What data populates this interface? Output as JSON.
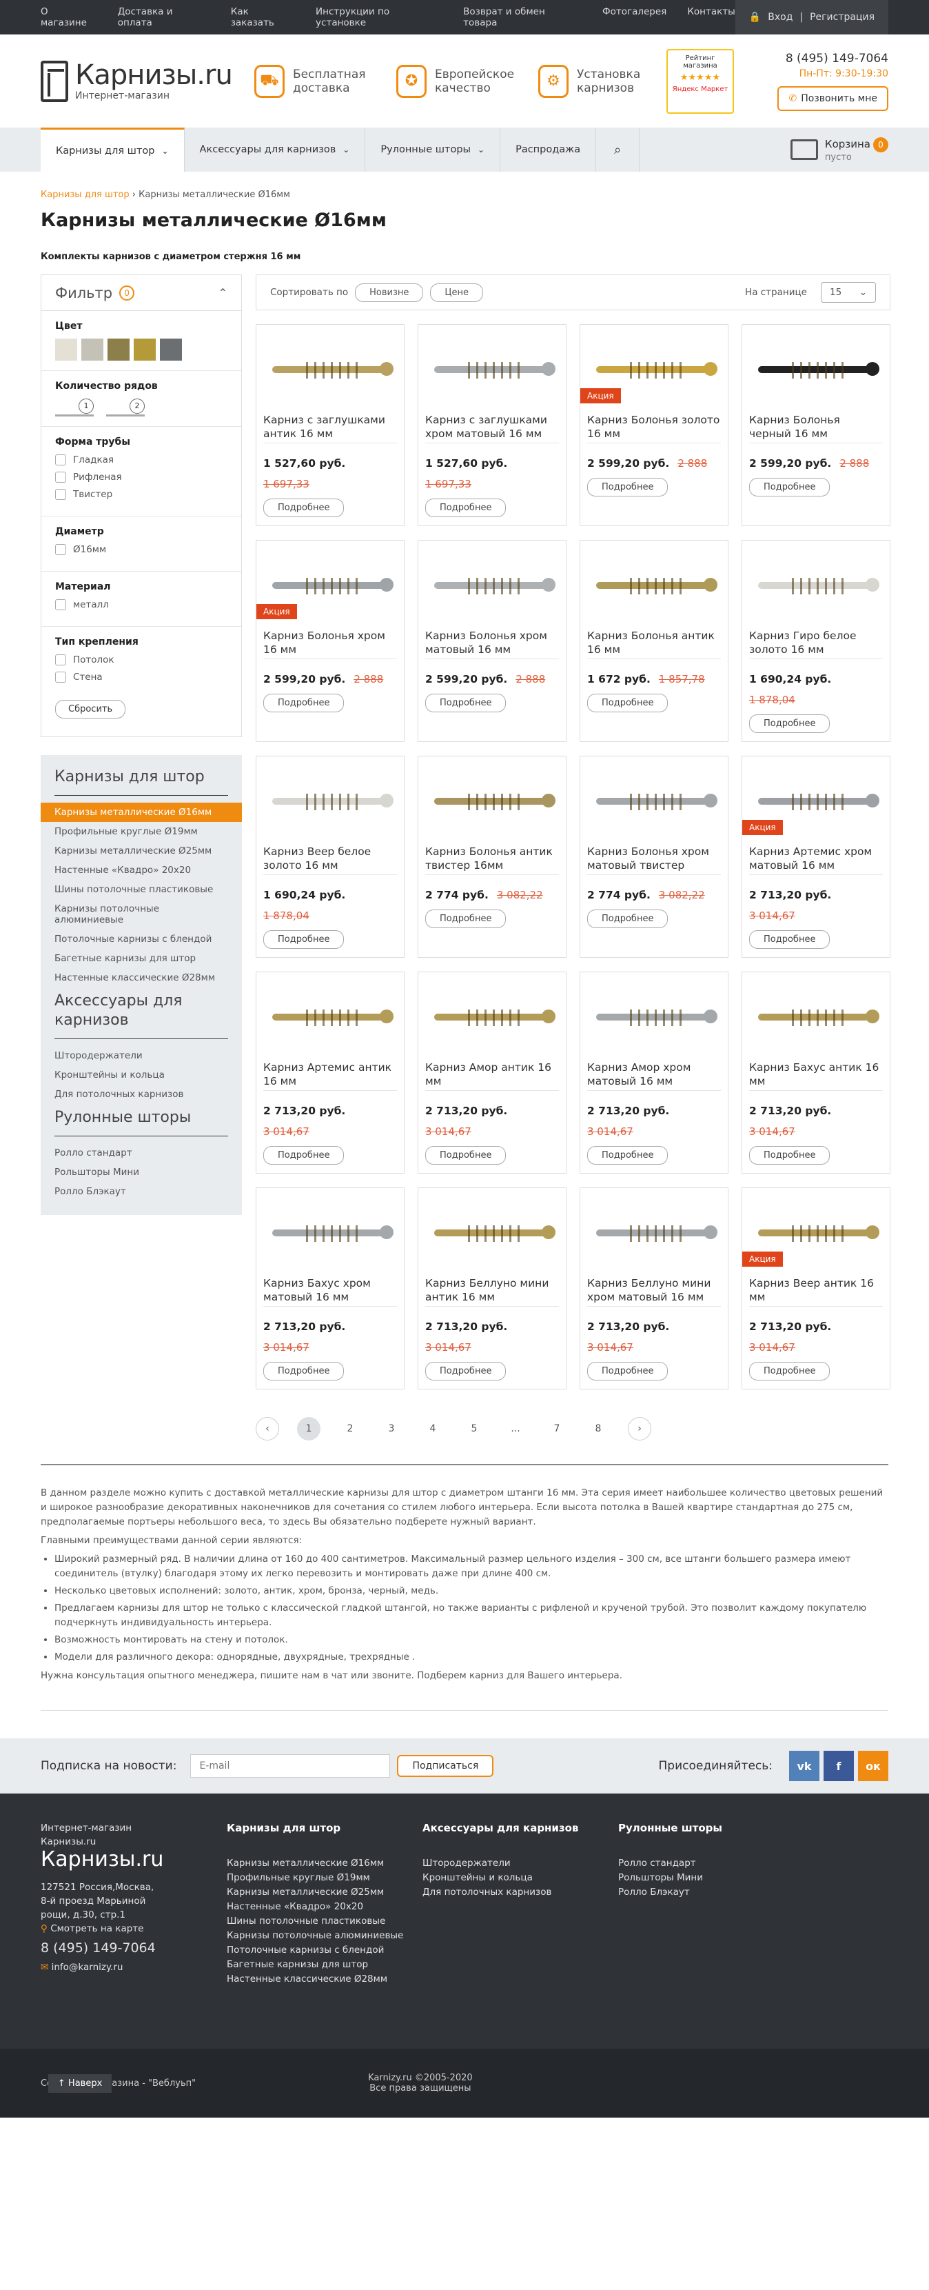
{
  "topnav": [
    "О магазине",
    "Доставка и оплата",
    "Как заказать",
    "Инструкции по установке",
    "Возврат и обмен товара",
    "Фотогалерея",
    "Контакты"
  ],
  "auth": {
    "login": "Вход",
    "register": "Регистрация"
  },
  "logo": {
    "name": "Карнизы.ru",
    "sub": "Интернет-магазин"
  },
  "features": [
    "Бесплатная доставка",
    "Европейское качество",
    "Установка карнизов"
  ],
  "rating": {
    "title": "Рейтинг магазина",
    "stars": "★★★★★",
    "source": "Яндекс Маркет"
  },
  "contacts": {
    "phone": "8 (495) 149-7064",
    "hours": "Пн-Пт: 9:30-19:30",
    "call": "Позвонить мне"
  },
  "mainnav": [
    "Карнизы для штор",
    "Аксессуары для карнизов",
    "Рулонные шторы",
    "Распродажа"
  ],
  "cart": {
    "label": "Корзина",
    "count": "0",
    "status": "пусто"
  },
  "breadcrumb": {
    "home": "Карнизы для штор",
    "sep": "›",
    "current": "Карнизы металлические Ø16мм"
  },
  "title": "Карнизы металлические Ø16мм",
  "subtitle": "Комплекты карнизов с диаметром стержня 16 мм",
  "filter": {
    "title": "Фильтр",
    "count": "0",
    "color_label": "Цвет",
    "swatches": [
      "#e4e0d4",
      "#c4c1b6",
      "#8c7f4a",
      "#b59a3a",
      "#6b6f72"
    ],
    "rows_label": "Количество рядов",
    "rows": [
      "1",
      "2"
    ],
    "shape_label": "Форма трубы",
    "shapes": [
      "Гладкая",
      "Рифленая",
      "Твистер"
    ],
    "diam_label": "Диаметр",
    "diams": [
      "Ø16мм"
    ],
    "mat_label": "Материал",
    "mats": [
      "металл"
    ],
    "mount_label": "Тип крепления",
    "mounts": [
      "Потолок",
      "Стена"
    ],
    "reset": "Сбросить"
  },
  "catnav": {
    "h1": "Карнизы для штор",
    "items1": [
      "Карнизы металлические Ø16мм",
      "Профильные круглые Ø19мм",
      "Карнизы металлические Ø25мм",
      "Настенные «Квадро» 20х20",
      "Шины потолочные пластиковые",
      "Карнизы потолочные алюминиевые",
      "Потолочные карнизы с блендой",
      "Багетные карнизы для штор",
      "Настенные классические Ø28мм"
    ],
    "h2": "Аксессуары для карнизов",
    "items2": [
      "Штородержатели",
      "Кронштейны и кольца",
      "Для потолочных карнизов"
    ],
    "h3": "Рулонные шторы",
    "items3": [
      "Ролло стандарт",
      "Рольшторы Мини",
      "Ролло Блэкаут"
    ]
  },
  "toolbar": {
    "sort": "Сортировать по",
    "new": "Новизне",
    "price": "Цене",
    "perpage": "На странице",
    "perpage_val": "15"
  },
  "sale_label": "Акция",
  "details": "Подробнее",
  "products": [
    {
      "name": "Карниз с заглушками антик 16 мм",
      "price": "1 527,60 руб.",
      "old": "1 697,33",
      "sale": false,
      "color": "#b8a060"
    },
    {
      "name": "Карниз с заглушками хром матовый 16 мм",
      "price": "1 527,60 руб.",
      "old": "1 697,33",
      "sale": false,
      "color": "#a9acaf"
    },
    {
      "name": "Карниз Болонья золото 16 мм",
      "price": "2 599,20 руб.",
      "old": "2 888",
      "sale": true,
      "color": "#c9a640"
    },
    {
      "name": "Карниз Болонья черный 16 мм",
      "price": "2 599,20 руб.",
      "old": "2 888",
      "sale": false,
      "color": "#222"
    },
    {
      "name": "Карниз Болонья хром 16 мм",
      "price": "2 599,20 руб.",
      "old": "2 888",
      "sale": true,
      "color": "#9fa4a8"
    },
    {
      "name": "Карниз Болонья хром матовый 16 мм",
      "price": "2 599,20 руб.",
      "old": "2 888",
      "sale": false,
      "color": "#aeb1b4"
    },
    {
      "name": "Карниз Болонья антик 16 мм",
      "price": "1 672 руб.",
      "old": "1 857,78",
      "sale": false,
      "color": "#b09a58"
    },
    {
      "name": "Карниз Гиро белое золото 16 мм",
      "price": "1 690,24 руб.",
      "old": "1 878,04",
      "sale": false,
      "color": "#d8d6d0"
    },
    {
      "name": "Карниз Веер белое золото 16 мм",
      "price": "1 690,24 руб.",
      "old": "1 878,04",
      "sale": false,
      "color": "#d8d6d0"
    },
    {
      "name": "Карниз Болонья антик твистер 16мм",
      "price": "2 774 руб.",
      "old": "3 082,22",
      "sale": false,
      "color": "#a89560"
    },
    {
      "name": "Карниз Болонья хром матовый твистер",
      "price": "2 774 руб.",
      "old": "3 082,22",
      "sale": false,
      "color": "#a4a7aa"
    },
    {
      "name": "Карниз Артемис хром матовый 16 мм",
      "price": "2 713,20 руб.",
      "old": "3 014,67",
      "sale": true,
      "color": "#9da1a5"
    },
    {
      "name": "Карниз Артемис антик 16 мм",
      "price": "2 713,20 руб.",
      "old": "3 014,67",
      "sale": false,
      "color": "#b29c58"
    },
    {
      "name": "Карниз Амор антик 16 мм",
      "price": "2 713,20 руб.",
      "old": "3 014,67",
      "sale": false,
      "color": "#b29c58"
    },
    {
      "name": "Карниз Амор хром матовый 16 мм",
      "price": "2 713,20 руб.",
      "old": "3 014,67",
      "sale": false,
      "color": "#a5a8ab"
    },
    {
      "name": "Карниз Бахус антик 16 мм",
      "price": "2 713,20 руб.",
      "old": "3 014,67",
      "sale": false,
      "color": "#b29c58"
    },
    {
      "name": "Карниз Бахус хром матовый 16 мм",
      "price": "2 713,20 руб.",
      "old": "3 014,67",
      "sale": false,
      "color": "#a5a8ab"
    },
    {
      "name": "Карниз Беллуно мини антик 16 мм",
      "price": "2 713,20 руб.",
      "old": "3 014,67",
      "sale": false,
      "color": "#b29c58"
    },
    {
      "name": "Карниз Беллуно мини хром матовый 16 мм",
      "price": "2 713,20 руб.",
      "old": "3 014,67",
      "sale": false,
      "color": "#a5a8ab"
    },
    {
      "name": "Карниз Веер антик 16 мм",
      "price": "2 713,20 руб.",
      "old": "3 014,67",
      "sale": true,
      "color": "#b29c58"
    }
  ],
  "pager": [
    "1",
    "2",
    "3",
    "4",
    "5",
    "...",
    "7",
    "8"
  ],
  "description": {
    "p1": "В данном разделе можно купить с доставкой металлические карнизы для штор с диаметром штанги 16 мм. Эта серия имеет наибольшее количество цветовых решений и широкое разнообразие декоративных наконечников для сочетания со стилем любого интерьера. Если высота потолка в Вашей квартире стандартная до 275 см, предполагаемые портьеры небольшого веса, то здесь Вы обязательно подберете нужный вариант.",
    "p2": "Главными преимуществами данной серии являются:",
    "items": [
      "Широкий размерный ряд. В наличии длина от 160 до 400 сантиметров. Максимальный размер цельного изделия – 300 см, все штанги большего размера имеют соединитель (втулку) благодаря этому их легко перевозить и монтировать даже при длине 400 см.",
      "Несколько цветовых исполнений: золото, антик, хром, бронза, черный, медь.",
      "Предлагаем карнизы для штор не только с классической гладкой штангой, но также варианты с рифленой и крученой трубой. Это позволит каждому покупателю подчеркнуть индивидуальность интерьера.",
      "Возможность монтировать на стену и потолок.",
      "Модели для различного декора: однорядные, двухрядные, трехрядные ."
    ],
    "p3": "Нужна консультация опытного менеджера, пишите нам в чат или звоните. Подберем карниз для Вашего интерьера."
  },
  "newsletter": {
    "label": "Подписка на новости:",
    "placeholder": "E-mail",
    "button": "Подписаться",
    "social": "Присоединяйтесь:"
  },
  "footer": {
    "shop": "Интернет-магазин Карнизы.ru",
    "logo": "Карнизы.ru",
    "address": "127521 Россия,Москва, 8-й проезд Марьиной рощи, д.30, стр.1",
    "map": "Смотреть на карте",
    "phone": "8 (495) 149-7064",
    "email": "info@karnizy.ru",
    "col1_h": "Карнизы для штор",
    "col1": [
      "Карнизы металлические Ø16мм",
      "Профильные круглые Ø19мм",
      "Карнизы металлические Ø25мм",
      "Настенные «Квадро» 20х20",
      "Шины потолочные пластиковые",
      "Карнизы потолочные алюминиевые",
      "Потолочные карнизы с блендой",
      "Багетные карнизы для штор",
      "Настенные классические Ø28мм"
    ],
    "col2_h": "Аксессуары для карнизов",
    "col2": [
      "Штородержатели",
      "Кронштейны и кольца",
      "Для потолочных карнизов"
    ],
    "col3_h": "Рулонные шторы",
    "col3": [
      "Ролло стандарт",
      "Рольшторы Мини",
      "Ролло Блэкаут"
    ],
    "made": "Созда",
    "made2": "азина - \"Веблуьп\"",
    "up": "↑ Наверх",
    "copy1": "Karnizy.ru ©2005-2020",
    "copy2": "Все права защищены"
  }
}
